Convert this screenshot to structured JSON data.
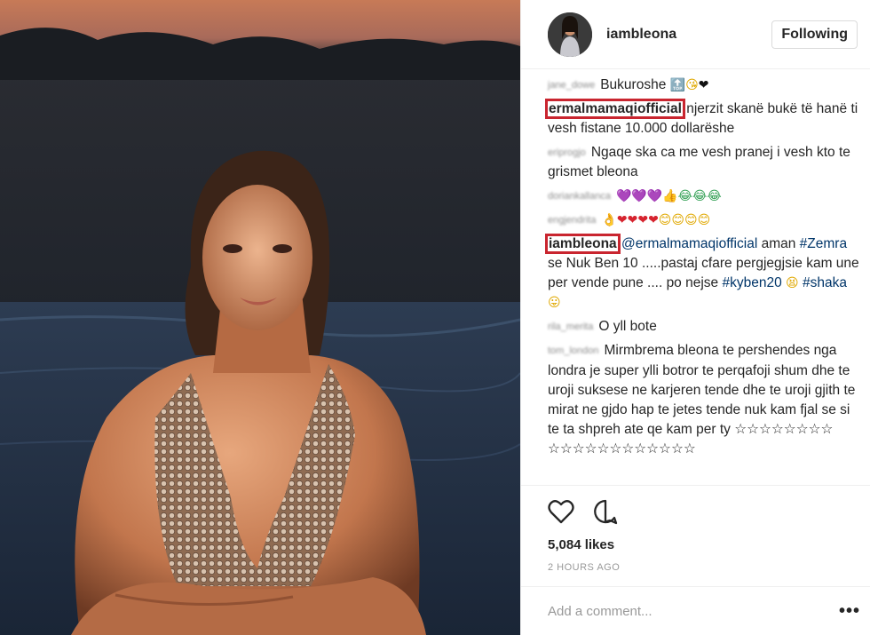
{
  "post": {
    "username": "iambleona",
    "follow_label": "Following",
    "likes": "5,084 likes",
    "time": "2 HOURS AGO",
    "add_comment_placeholder": "Add a comment...",
    "more_label": "•••"
  },
  "comments": [
    {
      "user": "jane_dowe",
      "blurred": true,
      "text": "Bukuroshe",
      "emoji": "🔝😘❤"
    },
    {
      "user": "ermalmamaqiofficial",
      "blurred": false,
      "boxed": true,
      "text": " njerzit skanë bukë të hanë ti vesh fistane 10.000 dollarëshe"
    },
    {
      "user": "eriprogjo",
      "blurred": true,
      "text": "Ngaqe ska ca me vesh pranej i vesh kto te grismet bleona"
    },
    {
      "user": "doriankallanca",
      "blurred": true,
      "text": "",
      "emoji": "💜💜💜👍😂😂😂"
    },
    {
      "user": "engjendrita",
      "blurred": true,
      "text": "",
      "emoji": "👌❤❤❤❤😊😊😊😊"
    },
    {
      "user": "iambleona",
      "blurred": false,
      "boxed": true,
      "mention": "@ermalmamaqiofficial",
      "text_1": " aman ",
      "hashtag_1": "#Zemra",
      "text_2": " se Nuk Ben 10 .....pastaj cfare pergjegjsie kam une per vende pune .... po nejse ",
      "hashtag_2": "#kyben20",
      "emoji_1": "😫",
      "hashtag_3": "#shaka",
      "emoji_2": "😛"
    },
    {
      "user": "rila_merita",
      "blurred": true,
      "text": "O yll bote"
    },
    {
      "user": "tom_london",
      "blurred": true,
      "text": "Mirmbrema bleona te pershendes nga londra je super ylli botror te perqafoji shum dhe te uroji suksese ne karjeren tende dhe te uroji gjith te mirat ne gjdo hap te jetes tende nuk kam fjal se si te ta shpreh ate qe kam per ty ☆☆☆☆☆☆☆☆ ☆☆☆☆☆☆☆☆☆☆☆☆"
    }
  ],
  "icons": {
    "like": "heart-outline-icon",
    "comment": "speech-bubble-icon"
  },
  "colors": {
    "highlight_box": "#c9252f",
    "hashtag": "#003569",
    "muted": "#999999"
  }
}
